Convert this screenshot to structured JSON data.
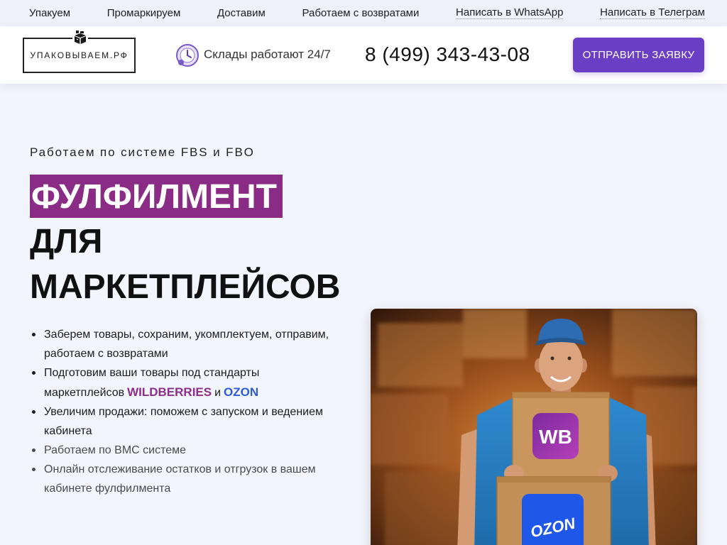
{
  "topnav": {
    "items": [
      "Упакуем",
      "Промаркируем",
      "Доставим",
      "Работаем с возвратами"
    ],
    "links": [
      "Написать в WhatsApp",
      "Написать в Телеграм"
    ]
  },
  "header": {
    "logo_text": "УПАКОВЫВАЕМ.РФ",
    "logo_icon": "box-icon",
    "hours_icon": "clock-icon",
    "hours": "Склады работают 24/7",
    "phone": "8 (499) 343-43-08",
    "cta_label": "ОТПРАВИТЬ ЗАЯВКУ"
  },
  "hero": {
    "subtitle": "Работаем по системе FBS и FBO",
    "title": {
      "highlight": "ФУЛФИЛМЕНТ",
      "line2": "ДЛЯ",
      "line3": "МАРКЕТПЛЕЙСОВ"
    },
    "bullets": [
      {
        "lines": [
          "Заберем товары, сохраним, укомплектуем, отправим,",
          "работаем с возвратами"
        ]
      },
      {
        "line1": "Подготовим ваши товары под стандарты",
        "line2_prefix": "маркетплейсов",
        "wildberries": "WILDBERRIES",
        "conj": "и",
        "ozon": "OZON"
      },
      {
        "lines": [
          "Увеличим продажи: поможем с запуском и ведением",
          "кабинета"
        ]
      },
      {
        "lines": [
          "Работаем по ВМС системе"
        ]
      },
      {
        "lines": [
          "Онлайн отслеживание остатков и отгрузок в вашем",
          "кабинете фулфилмента"
        ]
      }
    ]
  },
  "photo": {
    "box_top_label": "WB",
    "box_bottom_label": "OZON"
  },
  "colors": {
    "accent_purple": "#6b3ec6",
    "highlight_magenta": "#8a2b86",
    "wildberries": "#8b2d8c",
    "ozon": "#2d5bd8",
    "page_bg": "#f3f5fc",
    "topnav_bg": "#eef1f9"
  }
}
